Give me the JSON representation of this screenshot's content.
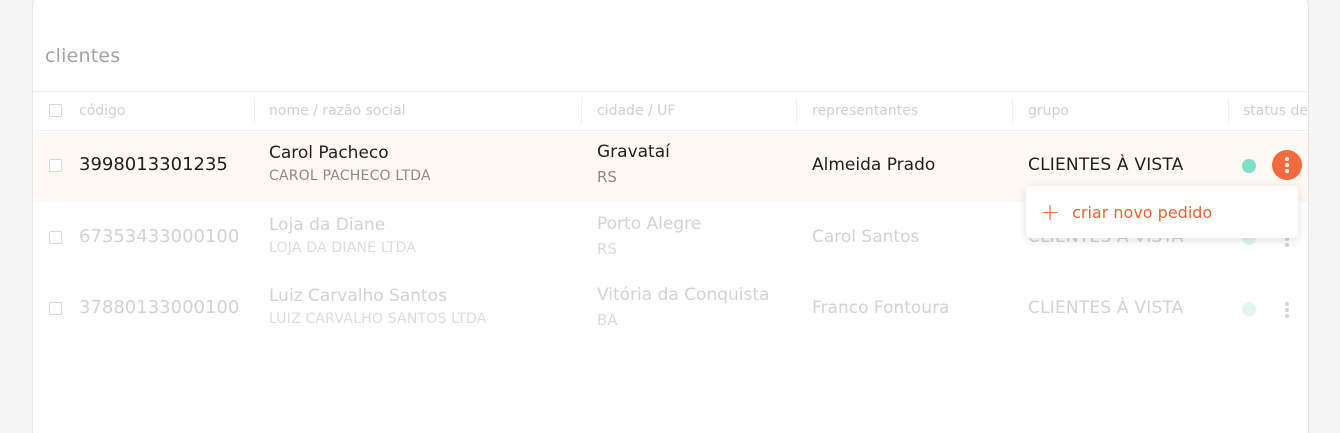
{
  "section_title": "clientes",
  "columns": [
    "código",
    "nome / razão social",
    "cidade / UF",
    "representantes",
    "grupo",
    "status de"
  ],
  "rows": [
    {
      "code": "3998013301235",
      "name": "Carol Pacheco",
      "company": "CAROL PACHECO LTDA",
      "city": "Gravataí",
      "uf": "RS",
      "rep": "Almeida Prado",
      "group": "CLIENTES À VISTA",
      "active": true
    },
    {
      "code": "67353433000100",
      "name": "Loja da Diane",
      "company": "LOJA DA DIANE LTDA",
      "city": "Porto Alegre",
      "uf": "RS",
      "rep": "Carol Santos",
      "group": "CLIENTES À VISTA",
      "active": false
    },
    {
      "code": "37880133000100",
      "name": "Luiz Carvalho Santos",
      "company": "LUIZ CARVALHO SANTOS LTDA",
      "city": "Vitória da Conquista",
      "uf": "BA",
      "rep": "Franco Fontoura",
      "group": "CLIENTES À VISTA",
      "active": false
    }
  ],
  "menu": {
    "create_order": "criar novo pedido"
  },
  "colors": {
    "accent": "#f26a3d",
    "status_active": "#7fe0c8",
    "row_highlight": "#fff8f3"
  },
  "icons": {
    "menu": "kebab-vertical-icon",
    "add": "plus-icon"
  }
}
